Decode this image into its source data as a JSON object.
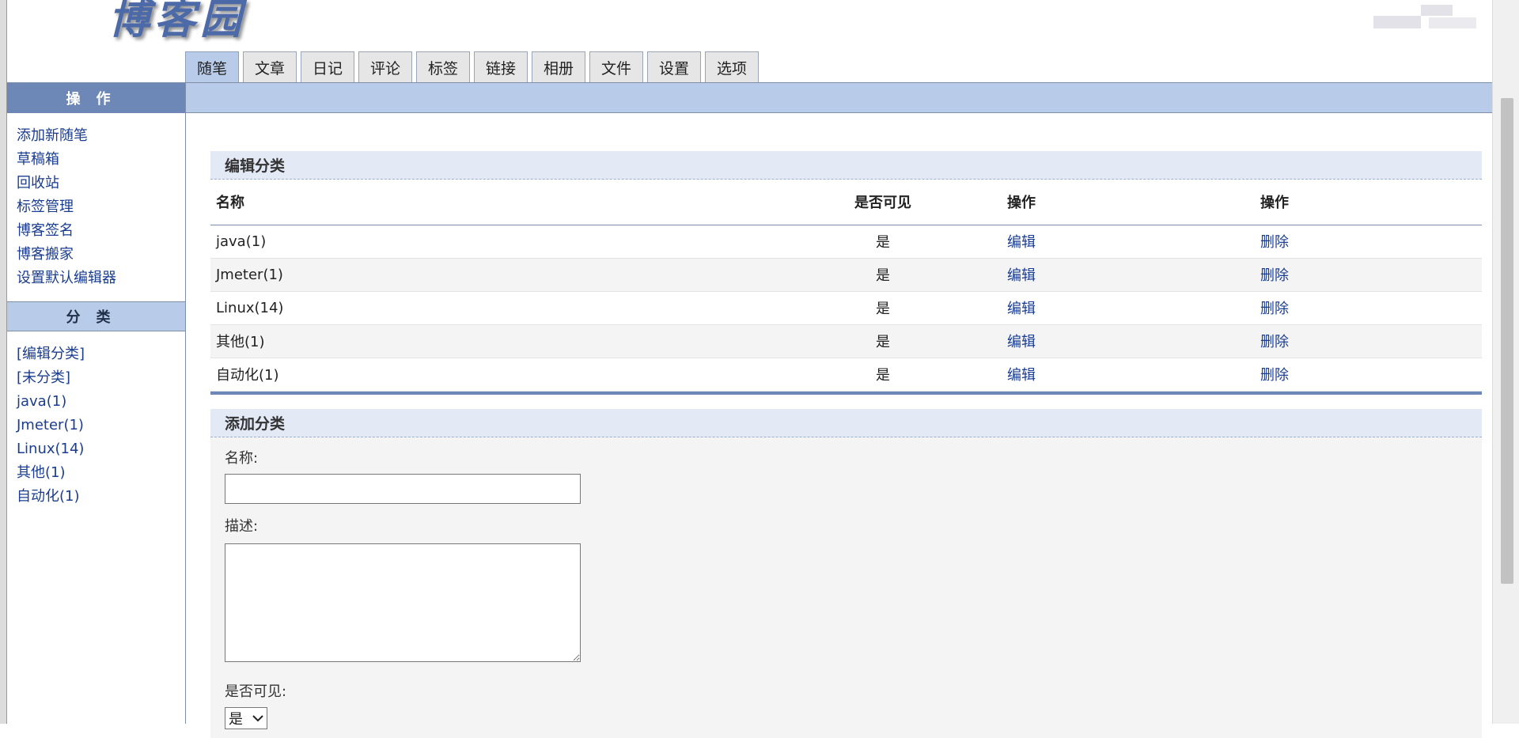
{
  "header": {
    "logo_text": "博客园"
  },
  "tabs": [
    {
      "label": "随笔",
      "active": true
    },
    {
      "label": "文章"
    },
    {
      "label": "日记"
    },
    {
      "label": "评论"
    },
    {
      "label": "标签"
    },
    {
      "label": "链接"
    },
    {
      "label": "相册"
    },
    {
      "label": "文件"
    },
    {
      "label": "设置"
    },
    {
      "label": "选项"
    }
  ],
  "sidebar": {
    "ops_title": "操作",
    "ops_items": [
      "添加新随笔",
      "草稿箱",
      "回收站",
      "标签管理",
      "博客签名",
      "博客搬家",
      "设置默认编辑器"
    ],
    "cat_title": "分类",
    "cat_items": [
      "[编辑分类]",
      "[未分类]",
      "java(1)",
      "Jmeter(1)",
      "Linux(14)",
      "其他(1)",
      "自动化(1)"
    ]
  },
  "edit_section": {
    "title": "编辑分类",
    "headers": [
      "名称",
      "是否可见",
      "操作",
      "操作"
    ],
    "rows": [
      {
        "name": "java(1)",
        "visible": "是",
        "edit": "编辑",
        "delete": "删除"
      },
      {
        "name": "Jmeter(1)",
        "visible": "是",
        "edit": "编辑",
        "delete": "删除"
      },
      {
        "name": "Linux(14)",
        "visible": "是",
        "edit": "编辑",
        "delete": "删除"
      },
      {
        "name": "其他(1)",
        "visible": "是",
        "edit": "编辑",
        "delete": "删除"
      },
      {
        "name": "自动化(1)",
        "visible": "是",
        "edit": "编辑",
        "delete": "删除"
      }
    ]
  },
  "add_section": {
    "title": "添加分类",
    "name_label": "名称:",
    "name_value": "",
    "desc_label": "描述:",
    "desc_value": "",
    "visible_label": "是否可见:",
    "visible_selected": "是"
  },
  "colors": {
    "tab_active": "#b8cbe8",
    "sidebar_head": "#6d88b6",
    "link": "#1a3d8f"
  }
}
